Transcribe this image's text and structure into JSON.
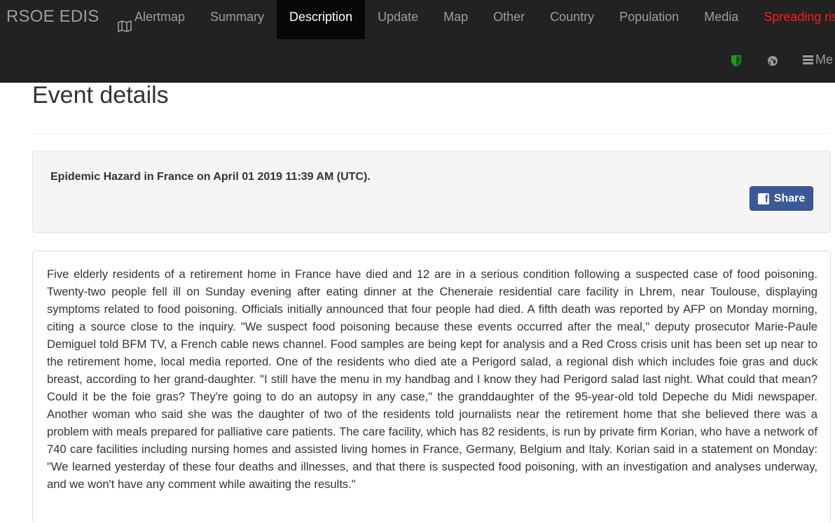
{
  "navbar": {
    "brand": "RSOE EDIS",
    "items": [
      {
        "label": "Alertmap",
        "icon": "map-icon"
      },
      {
        "label": "Summary"
      },
      {
        "label": "Description",
        "active": true
      },
      {
        "label": "Update"
      },
      {
        "label": "Map"
      },
      {
        "label": "Other"
      },
      {
        "label": "Country"
      },
      {
        "label": "Population"
      },
      {
        "label": "Media"
      },
      {
        "label": "Spreading ris",
        "color": "#ff1a1a"
      }
    ],
    "secondary": {
      "shield_icon": "shield-icon",
      "shield_color": "#1f9c1f",
      "globe_icon": "globe-icon",
      "menu_label": "Me",
      "menu_icon": "hamburger-icon"
    }
  },
  "page": {
    "title": "Event details"
  },
  "event": {
    "heading": "Epidemic Hazard in France on April 01 2019 11:39 AM (UTC).",
    "share_label": "Share",
    "share_icon": "facebook-icon",
    "share_color": "#3b5998"
  },
  "description": {
    "text": "Five elderly residents of a retirement home in France have died and 12 are in a serious condition following a suspected case of food poisoning. Twenty-two people fell ill on Sunday evening after eating dinner at the Cheneraie residential care facility in Lhrem, near Toulouse, displaying symptoms related to food poisoning. Officials initially announced that four people had died. A fifth death was reported by AFP on Monday morning, citing a source close to the inquiry. \"We suspect food poisoning because these events occurred after the meal,\" deputy prosecutor Marie-Paule Demiguel told BFM TV, a French cable news channel. Food samples are being kept for analysis and a Red Cross crisis unit has been set up near to the retirement home, local media reported. One of the residents who died ate a Perigord salad, a regional dish which includes foie gras and duck breast, according to her grand-daughter. \"I still have the menu in my handbag and I know they had Perigord salad last night. What could that mean? Could it be the foie gras? They're going to do an autopsy in any case,\" the granddaughter of the 95-year-old told Depeche du Midi newspaper. Another woman who said she was the daughter of two of the residents told journalists near the retirement home that she believed there was a problem with meals prepared for palliative care patients. The care facility, which has 82 residents, is run by private firm Korian, who have a network of 740 care facilities including nursing homes and assisted living homes in France, Germany, Belgium and Italy. Korian said in a statement on Monday: \"We learned yesterday of these four deaths and illnesses, and that there is suspected food poisoning, with an investigation and analyses underway, and we won't have any comment while awaiting the results.\""
  }
}
